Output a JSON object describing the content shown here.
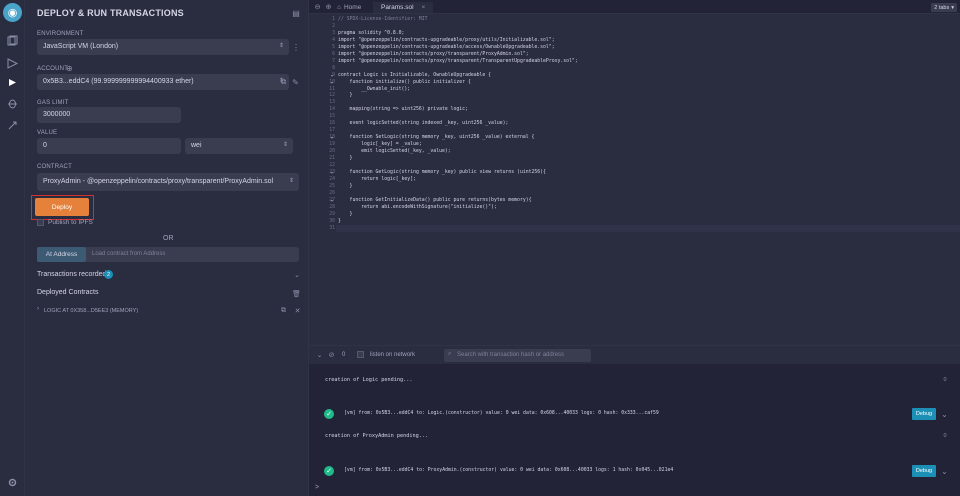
{
  "panel": {
    "title": "DEPLOY & RUN TRANSACTIONS",
    "environment_label": "ENVIRONMENT",
    "environment_value": "JavaScript VM (London)",
    "account_label": "ACCOUNT",
    "account_value": "0x5B3...eddC4 (99.999999999994400933 ether)",
    "gas_limit_label": "GAS LIMIT",
    "gas_limit_value": "3000000",
    "value_label": "VALUE",
    "value_value": "0",
    "value_unit": "wei",
    "contract_label": "CONTRACT",
    "contract_value": "ProxyAdmin - @openzeppelin/contracts/proxy/transparent/ProxyAdmin.sol",
    "deploy_label": "Deploy",
    "publish_label": "Publish to IPFS",
    "or_label": "OR",
    "at_address_label": "At Address",
    "load_placeholder": "Load contract from Address",
    "tx_recorded_label": "Transactions recorded",
    "tx_recorded_count": "2",
    "deployed_label": "Deployed Contracts",
    "deployed_item": "LOGIC AT 0X358...D5EE3 (MEMORY)"
  },
  "editor": {
    "tabs": [
      {
        "label": "Home"
      },
      {
        "label": "Params.sol"
      }
    ],
    "tabs_count": "2 tabs",
    "lines": [
      {
        "n": "1",
        "t": "// SPDX-License-Identifier: MIT"
      },
      {
        "n": "2",
        "t": ""
      },
      {
        "n": "3",
        "t": "pragma solidity ^0.8.0;"
      },
      {
        "n": "4",
        "t": "import \"@openzeppelin/contracts-upgradeable/proxy/utils/Initializable.sol\";"
      },
      {
        "n": "5",
        "t": "import \"@openzeppelin/contracts-upgradeable/access/OwnableUpgradeable.sol\";"
      },
      {
        "n": "6",
        "t": "import \"@openzeppelin/contracts/proxy/transparent/ProxyAdmin.sol\";"
      },
      {
        "n": "7",
        "t": "import \"@openzeppelin/contracts/proxy/transparent/TransparentUpgradeableProxy.sol\";"
      },
      {
        "n": "8",
        "t": ""
      },
      {
        "n": "9",
        "t": "contract Logic is Initializable, OwnableUpgradeable {"
      },
      {
        "n": "10",
        "t": "    function initialize() public initializer {"
      },
      {
        "n": "11",
        "t": "        __Ownable_init();"
      },
      {
        "n": "12",
        "t": "    }"
      },
      {
        "n": "13",
        "t": ""
      },
      {
        "n": "14",
        "t": "    mapping(string => uint256) private logic;"
      },
      {
        "n": "15",
        "t": ""
      },
      {
        "n": "16",
        "t": "    event logicSetted(string indexed _key, uint256 _value);"
      },
      {
        "n": "17",
        "t": ""
      },
      {
        "n": "18",
        "t": "    function SetLogic(string memory _key, uint256 _value) external {"
      },
      {
        "n": "19",
        "t": "        logic[_key] = _value;"
      },
      {
        "n": "20",
        "t": "        emit logicSetted(_key, _value);"
      },
      {
        "n": "21",
        "t": "    }"
      },
      {
        "n": "22",
        "t": ""
      },
      {
        "n": "23",
        "t": "    function GetLogic(string memory _key) public view returns (uint256){"
      },
      {
        "n": "24",
        "t": "        return logic[_key];"
      },
      {
        "n": "25",
        "t": "    }"
      },
      {
        "n": "26",
        "t": ""
      },
      {
        "n": "27",
        "t": "    function GetInitializeData() public pure returns(bytes memory){"
      },
      {
        "n": "28",
        "t": "        return abi.encodeWithSignature(\"initialize()\");"
      },
      {
        "n": "29",
        "t": "    }"
      },
      {
        "n": "30",
        "t": "}"
      },
      {
        "n": "31",
        "t": ""
      }
    ]
  },
  "terminal": {
    "count": "0",
    "listen_label": "listen on network",
    "search_placeholder": "Search with transaction hash or address",
    "logs": [
      {
        "text": "creation of Logic pending..."
      },
      {
        "text": "[vm]  from: 0x5B3...eddC4 to: Logic.(constructor) value: 0 wei data: 0x608...40033 logs: 0 hash: 0x333...caf59"
      },
      {
        "text": "creation of ProxyAdmin pending..."
      },
      {
        "text": "[vm]  from: 0x5B3...eddC4 to: ProxyAdmin.(constructor) value: 0 wei data: 0x608...40033 logs: 1 hash: 0x045...021e4"
      }
    ],
    "debug_label": "Debug",
    "prompt": ">"
  },
  "colors": {
    "accent": "#1b8fb5",
    "deploy": "#e5813a",
    "highlight": "#d32f2f",
    "success": "#1fb98a"
  }
}
